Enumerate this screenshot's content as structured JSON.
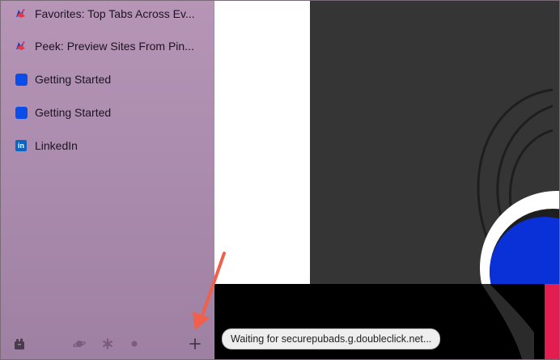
{
  "sidebar": {
    "tabs": [
      {
        "label": "Favorites: Top Tabs Across Ev...",
        "icon": "arc-bird-icon"
      },
      {
        "label": "Peek: Preview Sites From Pin...",
        "icon": "arc-bird-icon"
      },
      {
        "label": "Getting Started",
        "icon": "blue-square-icon"
      },
      {
        "label": "Getting Started",
        "icon": "blue-square-icon"
      },
      {
        "label": "LinkedIn",
        "icon": "linkedin-icon"
      }
    ],
    "linkedin_glyph": "in",
    "bottom_icons": [
      "archive-icon",
      "space-planet-icon",
      "space-asterisk-icon",
      "space-dot-icon",
      "new-tab-plus-icon"
    ]
  },
  "status": {
    "text": "Waiting for securepubads.g.doubleclick.net..."
  },
  "colors": {
    "sidebar_top": "#b695b6",
    "sidebar_bottom": "#9e80a3",
    "annotation_arrow": "#f0604a",
    "favicon_blue": "#0b4de8",
    "accent_pink": "#e21d4f"
  }
}
